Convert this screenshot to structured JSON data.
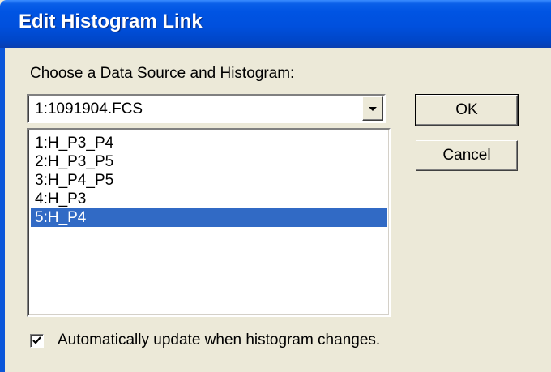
{
  "window": {
    "title": "Edit Histogram Link"
  },
  "prompt_label": "Choose a Data Source and Histogram:",
  "data_source": {
    "selected_value": "1:1091904.FCS",
    "dropdown_icon": "chevron-down-icon"
  },
  "histograms": {
    "items": [
      {
        "label": "1:H_P3_P4",
        "selected": false
      },
      {
        "label": "2:H_P3_P5",
        "selected": false
      },
      {
        "label": "3:H_P4_P5",
        "selected": false
      },
      {
        "label": "4:H_P3",
        "selected": false
      },
      {
        "label": "5:H_P4",
        "selected": true
      }
    ],
    "selection_color": "#316AC5"
  },
  "buttons": {
    "ok_label": "OK",
    "cancel_label": "Cancel"
  },
  "auto_update": {
    "label": "Automatically update when histogram changes.",
    "checked": true
  },
  "colors": {
    "titlebar": "#0054E3",
    "dialog_background": "#ECE9D8"
  }
}
